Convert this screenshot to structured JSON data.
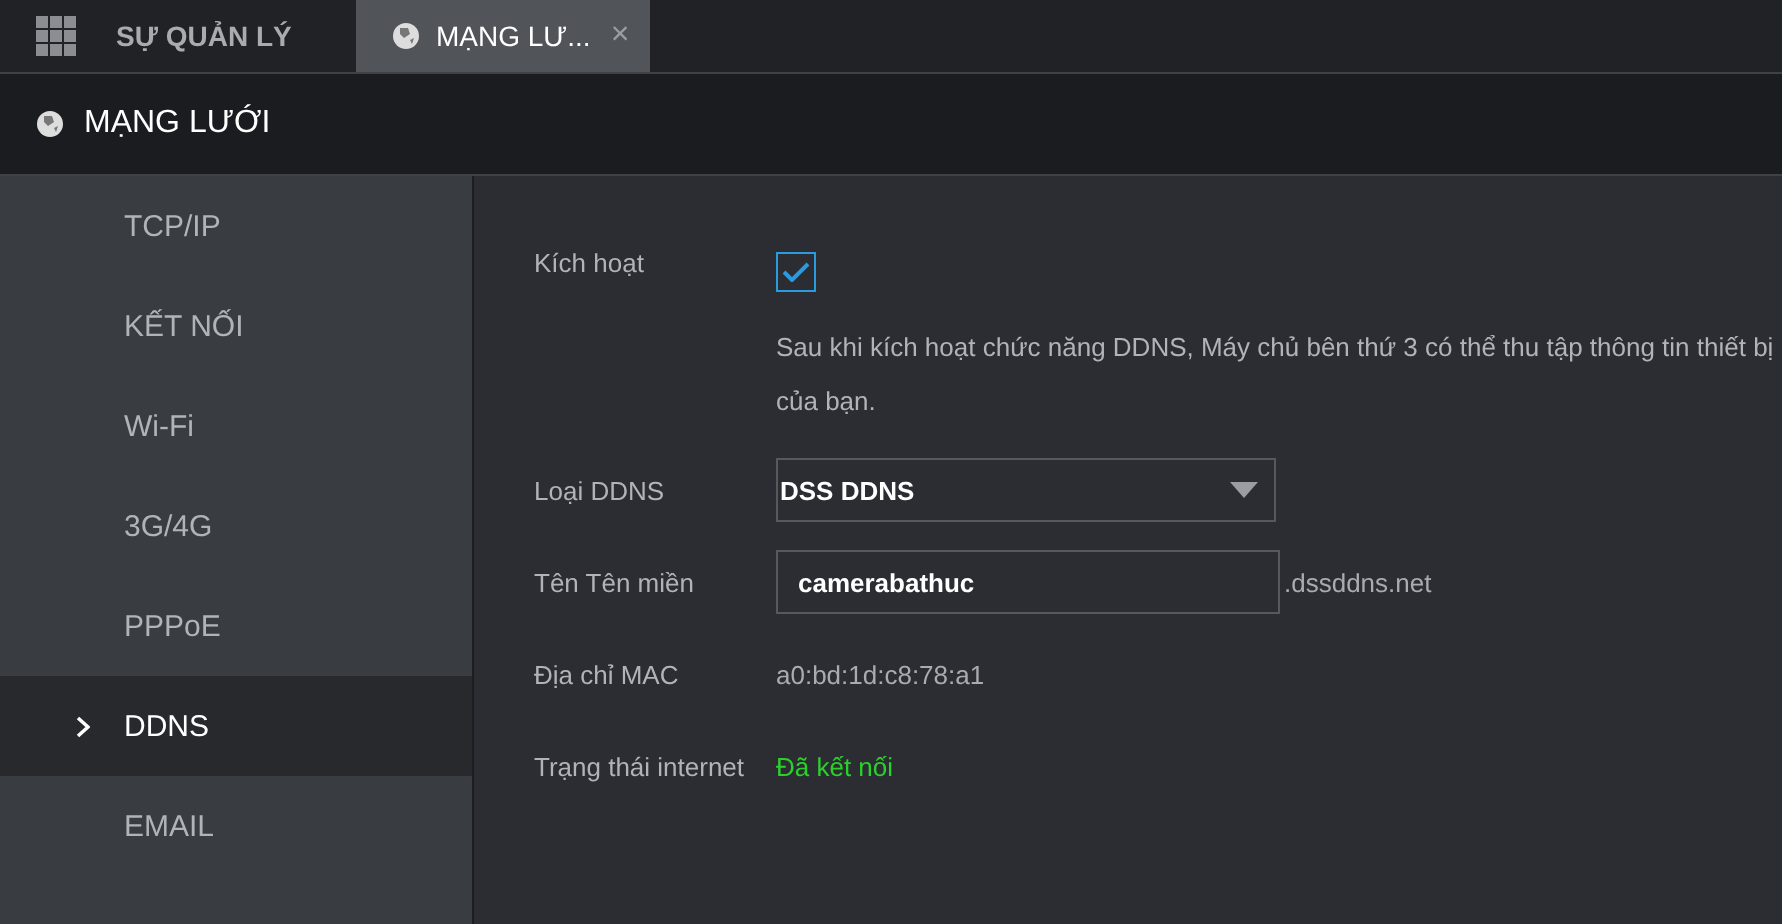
{
  "top_tabs": [
    {
      "label": "SỰ QUẢN LÝ",
      "kind": "apps",
      "selected": false
    },
    {
      "label": "MẠNG LƯ...",
      "kind": "globe",
      "selected": true,
      "close": "×"
    }
  ],
  "header": {
    "title": "MẠNG LƯỚI"
  },
  "sidebar": {
    "items": [
      {
        "label": "TCP/IP",
        "selected": false
      },
      {
        "label": "KẾT NỐI",
        "selected": false
      },
      {
        "label": "Wi-Fi",
        "selected": false
      },
      {
        "label": "3G/4G",
        "selected": false
      },
      {
        "label": "PPPoE",
        "selected": false
      },
      {
        "label": "DDNS",
        "selected": true
      },
      {
        "label": "EMAIL",
        "selected": false
      }
    ]
  },
  "form": {
    "enable": {
      "label": "Kích hoạt",
      "checked": true
    },
    "note": "Sau khi kích hoạt chức năng DDNS, Máy chủ bên thứ 3 có thể thu tập thông tin thiết bị của bạn.",
    "ddns_type": {
      "label": "Loại DDNS",
      "value": "DSS DDNS"
    },
    "domain": {
      "label": "Tên Tên miền",
      "value": "camerabathuc",
      "suffix": ".dssddns.net"
    },
    "mac": {
      "label": "Địa chỉ MAC",
      "value": "a0:bd:1d:c8:78:a1"
    },
    "internet": {
      "label": "Trạng thái internet",
      "value": "Đã kết nối",
      "connected": true
    }
  }
}
